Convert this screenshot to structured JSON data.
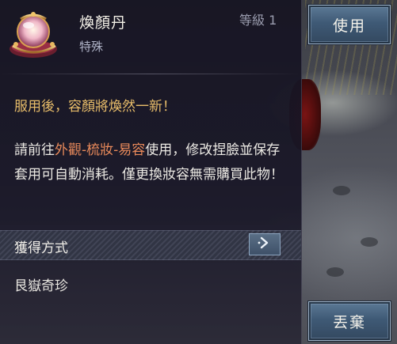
{
  "item": {
    "name": "煥顏丹",
    "type": "特殊",
    "level": "等級 1",
    "icon": "pill-jar-icon"
  },
  "effect": "服用後，容顏將煥然一新！",
  "description": {
    "part1": "請前往",
    "highlight": "外觀-梳妝-易容",
    "part2": "使用，修改捏臉並保存套用可自動消耗。僅更換妝容無需購買此物！"
  },
  "obtain": {
    "label": "獲得方式",
    "arrow_icon": "chevron-right-icon",
    "source": "艮嶽奇珍"
  },
  "buttons": {
    "use": "使用",
    "discard": "丟棄"
  },
  "colors": {
    "effect_text": "#e8bd6a",
    "highlight_text": "#e98a5a",
    "button_fill": "#3f5a76"
  }
}
